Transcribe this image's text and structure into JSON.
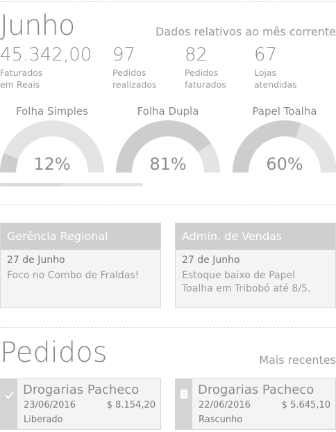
{
  "header": {
    "month": "Junho",
    "subtitle": "Dados relativos ao mês corrente"
  },
  "stats": [
    {
      "value": "45.342,00",
      "label_line1": "Faturados",
      "label_line2": "em Reais"
    },
    {
      "value": "97",
      "label_line1": "Pedidos",
      "label_line2": "realizados"
    },
    {
      "value": "82",
      "label_line1": "Pedidos",
      "label_line2": "faturados"
    },
    {
      "value": "67",
      "label_line1": "Lojas",
      "label_line2": "atendidas"
    }
  ],
  "gauges": [
    {
      "title": "Folha Simples",
      "percent_label": "12%",
      "value": 12
    },
    {
      "title": "Folha Dupla",
      "percent_label": "81%",
      "value": 81
    },
    {
      "title": "Papel Toalha",
      "percent_label": "60%",
      "value": 60
    }
  ],
  "progress": {
    "fraction": 0.43
  },
  "cards": [
    {
      "title": "Gerência Regional",
      "date": "27 de Junho",
      "text": "Foco no Combo de Fraldas!"
    },
    {
      "title": "Admin. de Vendas",
      "date": "27 de Junho",
      "text": "Estoque baixo de Papel Toalha em Tribobó até 8/5."
    }
  ],
  "orders_section": {
    "title": "Pedidos",
    "subtitle": "Mais recentes"
  },
  "orders": [
    {
      "icon": "check-icon",
      "name": "Drogarias Pacheco",
      "date": "23/06/2016",
      "amount": "$ 8.154,20",
      "status": "Liberado"
    },
    {
      "icon": "document-icon",
      "name": "Drogarias Pacheco",
      "date": "22/06/2016",
      "amount": "$ 5.645,10",
      "status": "Rascunho"
    }
  ],
  "colors": {
    "gauge_fill": "#cdcdcd",
    "gauge_track": "#e4e4e4",
    "card_header": "#cfcfcf"
  }
}
